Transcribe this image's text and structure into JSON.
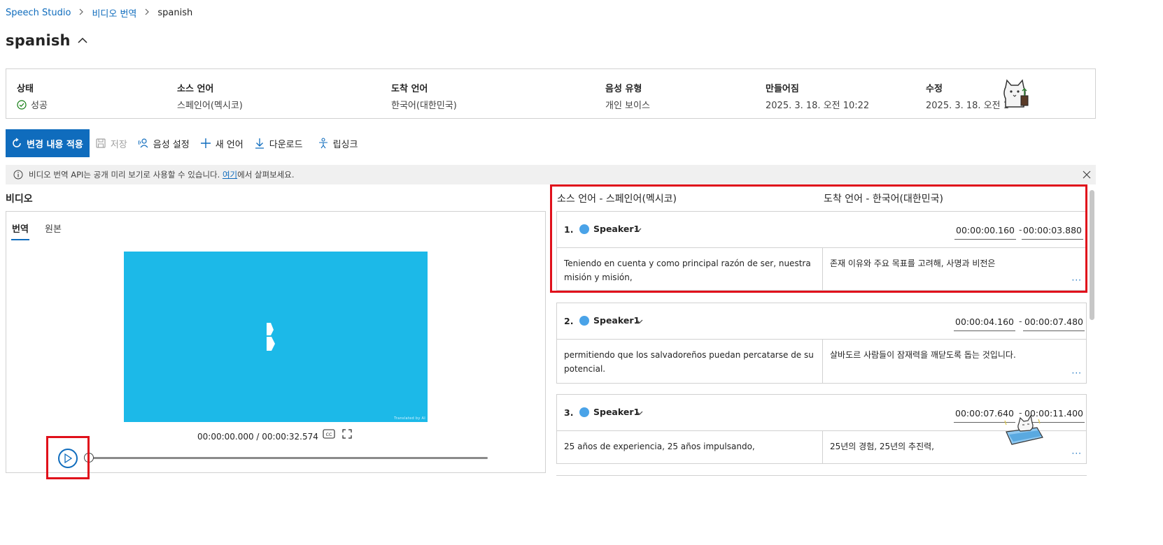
{
  "breadcrumb": {
    "items": [
      "Speech Studio",
      "비디오 번역"
    ],
    "current": "spanish"
  },
  "page": {
    "title": "spanish"
  },
  "info": {
    "status": {
      "label": "상태",
      "value": "성공"
    },
    "source_lang": {
      "label": "소스 언어",
      "value": "스페인어(멕시코)"
    },
    "target_lang": {
      "label": "도착 언어",
      "value": "한국어(대한민국)"
    },
    "voice_type": {
      "label": "음성 유형",
      "value": "개인 보이스"
    },
    "created": {
      "label": "만들어짐",
      "value": "2025. 3. 18. 오전 10:22"
    },
    "modified": {
      "label": "수정",
      "value": "2025. 3. 18. 오전 1"
    }
  },
  "toolbar": {
    "apply": "변경 내용 적용",
    "save": "저장",
    "voice_settings": "음성 설정",
    "new_language": "새 언어",
    "download": "다운로드",
    "lipsync": "립싱크"
  },
  "notice": {
    "text_before": "비디오 번역 API는 공개 미리 보기로 사용할 수 있습니다. ",
    "link": "여기",
    "text_after": "에서 살펴보세요."
  },
  "video": {
    "heading": "비디오",
    "tabs": [
      "번역",
      "원본"
    ],
    "active_tab": "번역",
    "time": "00:00:00.000 / 00:00:32.574",
    "watermark": "Translated by AI",
    "progress": 0
  },
  "segments_header": {
    "source": "소스 언어 - 스페인어(멕시코)",
    "target": "도착 언어 - 한국어(대한민국)"
  },
  "segments": [
    {
      "num": "1.",
      "speaker": "Speaker1",
      "start": "00:00:00.160",
      "end": "00:00:03.880",
      "source": "Teniendo en cuenta y como principal razón de ser, nuestra misión y misión,",
      "target": "존재 이유와 주요 목표를 고려해, 사명과 비전은"
    },
    {
      "num": "2.",
      "speaker": "Speaker1",
      "start": "00:00:04.160",
      "end": "00:00:07.480",
      "source": "permitiendo que los salvadoreños puedan percatarse de su potencial.",
      "target": "살바도르 사람들이 잠재력을 깨닫도록 돕는 것입니다."
    },
    {
      "num": "3.",
      "speaker": "Speaker1",
      "start": "00:00:07.640",
      "end": "00:00:11.400",
      "source": "25 años de experiencia, 25 años impulsando,",
      "target": "25년의 경험, 25년의 추진력,"
    }
  ],
  "colors": {
    "accent": "#0f6cbd",
    "highlight": "#e0101b",
    "video_bg": "#1cb9e8",
    "speaker_dot": "#4aa3e8"
  },
  "icons": [
    "chevron-right-icon",
    "chevron-up-icon",
    "check-circle-icon",
    "refresh-icon",
    "save-icon",
    "voice-settings-icon",
    "plus-icon",
    "download-icon",
    "lipsync-icon",
    "info-icon",
    "close-icon",
    "cc-icon",
    "fullscreen-icon",
    "play-icon",
    "chevron-down-icon"
  ]
}
